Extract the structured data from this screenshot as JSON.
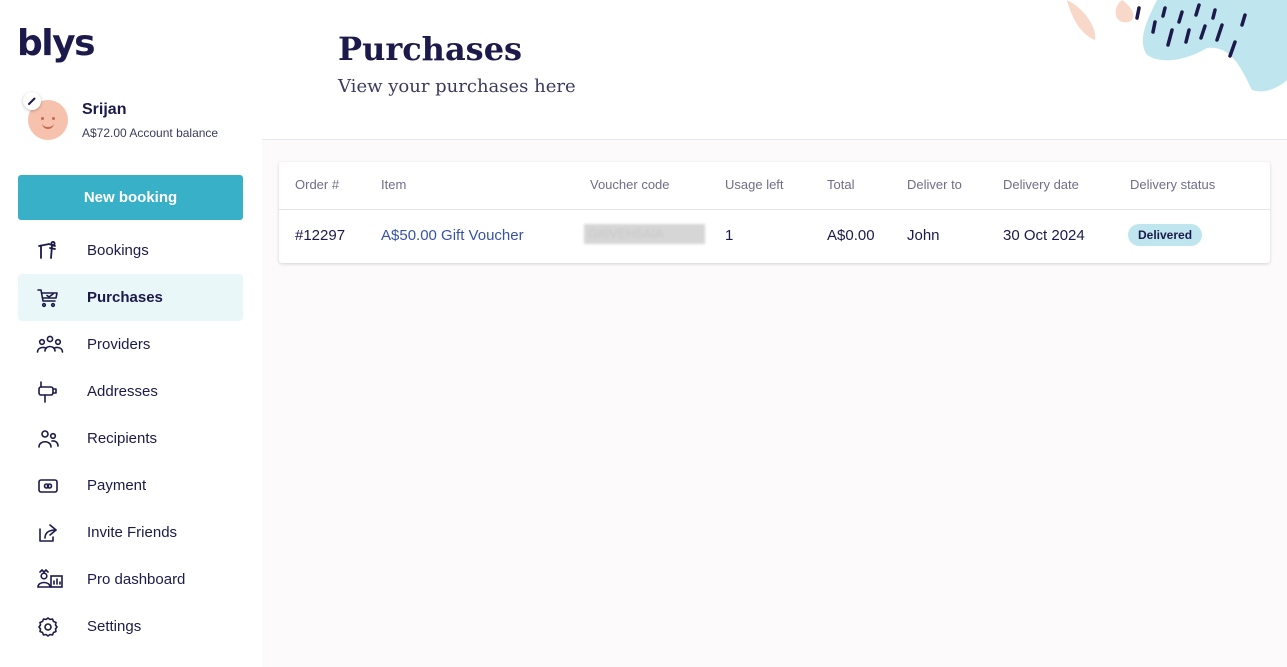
{
  "brand": {
    "logo_text": "blys"
  },
  "profile": {
    "name": "Srijan",
    "balance": "A$72.00 Account balance"
  },
  "sidebar": {
    "new_booking_label": "New booking",
    "items": [
      {
        "label": "Bookings",
        "icon": "massage-table-icon",
        "active": false
      },
      {
        "label": "Purchases",
        "icon": "cart-check-icon",
        "active": true
      },
      {
        "label": "Providers",
        "icon": "people-group-icon",
        "active": false
      },
      {
        "label": "Addresses",
        "icon": "mailbox-icon",
        "active": false
      },
      {
        "label": "Recipients",
        "icon": "users-icon",
        "active": false
      },
      {
        "label": "Payment",
        "icon": "payment-card-icon",
        "active": false
      },
      {
        "label": "Invite Friends",
        "icon": "share-icon",
        "active": false
      },
      {
        "label": "Pro dashboard",
        "icon": "pro-dashboard-icon",
        "active": false
      },
      {
        "label": "Settings",
        "icon": "gear-icon",
        "active": false
      }
    ]
  },
  "header": {
    "title": "Purchases",
    "subtitle": "View your purchases here"
  },
  "table": {
    "columns": [
      "Order #",
      "Item",
      "Voucher code",
      "Usage left",
      "Total",
      "Deliver to",
      "Delivery date",
      "Delivery status"
    ],
    "rows": [
      {
        "order": "#12297",
        "item": "A$50.00 Gift Voucher",
        "voucher_code": "GI6VEH5AIA",
        "usage_left": "1",
        "total": "A$0.00",
        "deliver_to": "John",
        "delivery_date": "30 Oct 2024",
        "delivery_status": "Delivered"
      }
    ]
  },
  "colors": {
    "brand_navy": "#1b1a4a",
    "accent_teal": "#38b0c8",
    "active_nav_bg": "#eaf7f9",
    "status_badge_bg": "#bfe6ee",
    "link_blue": "#3753a8"
  }
}
